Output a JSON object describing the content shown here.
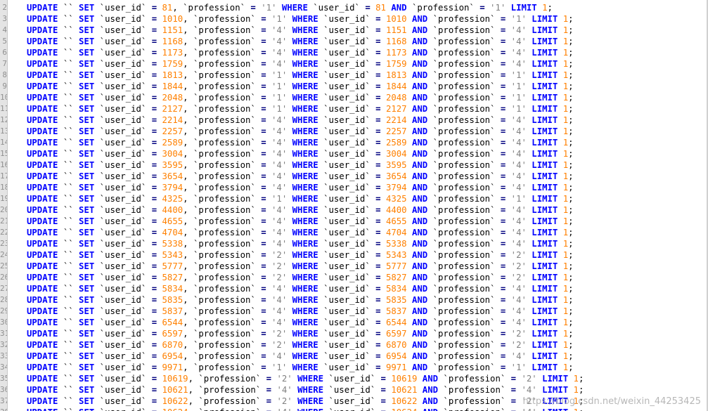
{
  "editor": {
    "language": "SQL",
    "colors": {
      "keyword": "#0000ff",
      "number": "#ff8000",
      "string": "#808080",
      "operator": "#000080",
      "gutter_bg": "#e4e4e4"
    },
    "first_line_number": 2,
    "watermark": "https://blog.csdn.net/weixin_44253425",
    "statement_pattern": "UPDATE `` SET `user_id` = {id}, `profession` = '{p}' WHERE `user_id` = {id} AND `profession` = '{p}' LIMIT 1;",
    "rows": [
      {
        "line": "2",
        "id": "81",
        "profession": "1"
      },
      {
        "line": "3",
        "id": "1010",
        "profession": "1"
      },
      {
        "line": "4",
        "id": "1151",
        "profession": "4"
      },
      {
        "line": "5",
        "id": "1168",
        "profession": "4"
      },
      {
        "line": "6",
        "id": "1173",
        "profession": "4"
      },
      {
        "line": "7",
        "id": "1759",
        "profession": "4"
      },
      {
        "line": "8",
        "id": "1813",
        "profession": "1"
      },
      {
        "line": "9",
        "id": "1844",
        "profession": "1"
      },
      {
        "line": "10",
        "id": "2048",
        "profession": "1"
      },
      {
        "line": "11",
        "id": "2127",
        "profession": "1"
      },
      {
        "line": "12",
        "id": "2214",
        "profession": "4"
      },
      {
        "line": "13",
        "id": "2257",
        "profession": "4"
      },
      {
        "line": "14",
        "id": "2589",
        "profession": "4"
      },
      {
        "line": "15",
        "id": "3004",
        "profession": "4"
      },
      {
        "line": "16",
        "id": "3595",
        "profession": "4"
      },
      {
        "line": "17",
        "id": "3654",
        "profession": "4"
      },
      {
        "line": "18",
        "id": "3794",
        "profession": "4"
      },
      {
        "line": "19",
        "id": "4325",
        "profession": "1"
      },
      {
        "line": "20",
        "id": "4400",
        "profession": "4"
      },
      {
        "line": "21",
        "id": "4655",
        "profession": "4"
      },
      {
        "line": "22",
        "id": "4704",
        "profession": "4"
      },
      {
        "line": "23",
        "id": "5338",
        "profession": "4"
      },
      {
        "line": "24",
        "id": "5343",
        "profession": "2"
      },
      {
        "line": "25",
        "id": "5777",
        "profession": "2"
      },
      {
        "line": "26",
        "id": "5827",
        "profession": "2"
      },
      {
        "line": "27",
        "id": "5834",
        "profession": "4"
      },
      {
        "line": "28",
        "id": "5835",
        "profession": "4"
      },
      {
        "line": "29",
        "id": "5837",
        "profession": "4"
      },
      {
        "line": "30",
        "id": "6544",
        "profession": "4"
      },
      {
        "line": "31",
        "id": "6597",
        "profession": "2"
      },
      {
        "line": "32",
        "id": "6870",
        "profession": "2"
      },
      {
        "line": "33",
        "id": "6954",
        "profession": "4"
      },
      {
        "line": "34",
        "id": "9971",
        "profession": "1"
      },
      {
        "line": "35",
        "id": "10619",
        "profession": "2"
      },
      {
        "line": "36",
        "id": "10621",
        "profession": "4"
      },
      {
        "line": "37",
        "id": "10622",
        "profession": "2"
      },
      {
        "line": "38",
        "id": "10624",
        "profession": "4"
      }
    ]
  }
}
